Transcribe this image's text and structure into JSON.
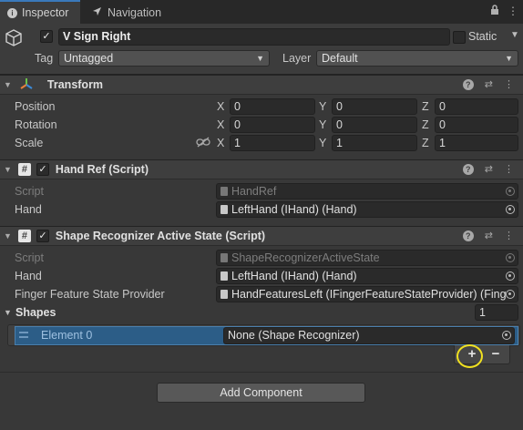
{
  "tabs": {
    "inspector": "Inspector",
    "navigation": "Navigation"
  },
  "game_object": {
    "name": "V Sign Right",
    "active": true,
    "static_label": "Static",
    "tag_label": "Tag",
    "tag_value": "Untagged",
    "layer_label": "Layer",
    "layer_value": "Default"
  },
  "transform": {
    "title": "Transform",
    "rows": [
      {
        "label": "Position",
        "x": "0",
        "y": "0",
        "z": "0"
      },
      {
        "label": "Rotation",
        "x": "0",
        "y": "0",
        "z": "0"
      },
      {
        "label": "Scale",
        "x": "1",
        "y": "1",
        "z": "1"
      }
    ],
    "axes": {
      "x": "X",
      "y": "Y",
      "z": "Z"
    }
  },
  "hand_ref": {
    "title": "Hand Ref (Script)",
    "script_label": "Script",
    "script_value": "HandRef",
    "hand_label": "Hand",
    "hand_value": "LeftHand (IHand) (Hand)"
  },
  "shape_recognizer": {
    "title": "Shape Recognizer Active State (Script)",
    "script_label": "Script",
    "script_value": "ShapeRecognizerActiveState",
    "hand_label": "Hand",
    "hand_value": "LeftHand (IHand) (Hand)",
    "finger_label": "Finger Feature State Provider",
    "finger_value": "HandFeaturesLeft (IFingerFeatureStateProvider) (Fing",
    "shapes_label": "Shapes",
    "shapes_count": "1",
    "element_label": "Element 0",
    "element_value": "None (Shape Recognizer)",
    "add_symbol": "+",
    "remove_symbol": "−"
  },
  "add_component_label": "Add Component",
  "colors": {
    "background": "#383838",
    "selected_row": "#2c5d87",
    "tab_accent": "#3a79bb",
    "highlight_circle": "#f0e020"
  }
}
